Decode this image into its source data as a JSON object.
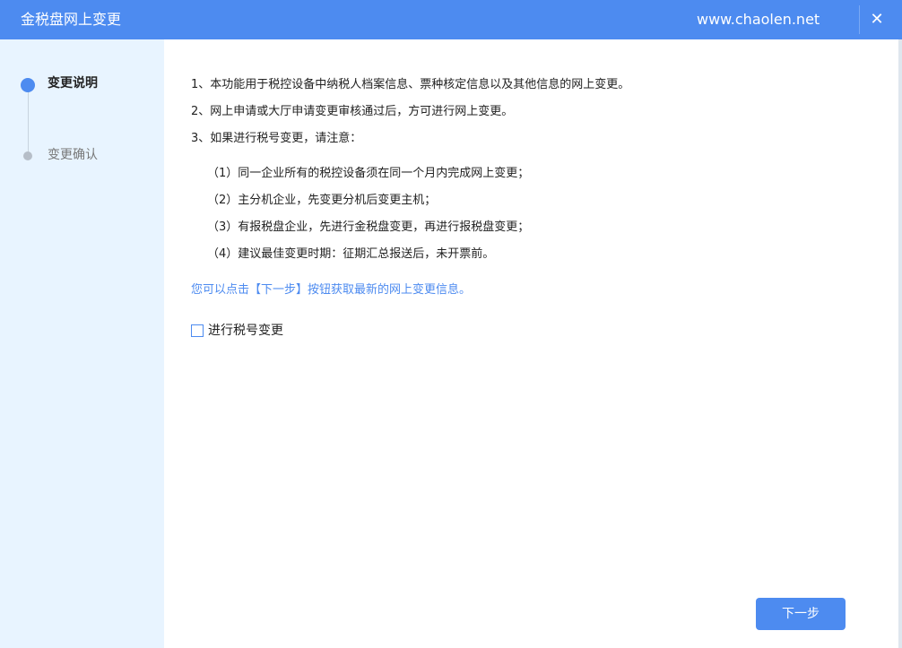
{
  "window": {
    "title": "金税盘网上变更",
    "watermark": "www.chaolen.net",
    "close_icon": "✕"
  },
  "sidebar": {
    "steps": [
      {
        "label": "变更说明",
        "state": "active"
      },
      {
        "label": "变更确认",
        "state": "inactive"
      }
    ]
  },
  "content": {
    "items": [
      "1、本功能用于税控设备中纳税人档案信息、票种核定信息以及其他信息的网上变更。",
      "2、网上申请或大厅申请变更审核通过后，方可进行网上变更。",
      "3、如果进行税号变更，请注意："
    ],
    "subitems": [
      "（1）同一企业所有的税控设备须在同一个月内完成网上变更；",
      "（2）主分机企业，先变更分机后变更主机；",
      "（3）有报税盘企业，先进行金税盘变更，再进行报税盘变更；",
      "（4）建议最佳变更时期：征期汇总报送后，未开票前。"
    ],
    "hint": "您可以点击【下一步】按钮获取最新的网上变更信息。",
    "checkbox": {
      "label": "进行税号变更",
      "checked": false
    }
  },
  "footer": {
    "next_label": "下一步"
  },
  "colors": {
    "accent": "#4d8bf0",
    "sidebar_bg": "#e8f4ff"
  }
}
